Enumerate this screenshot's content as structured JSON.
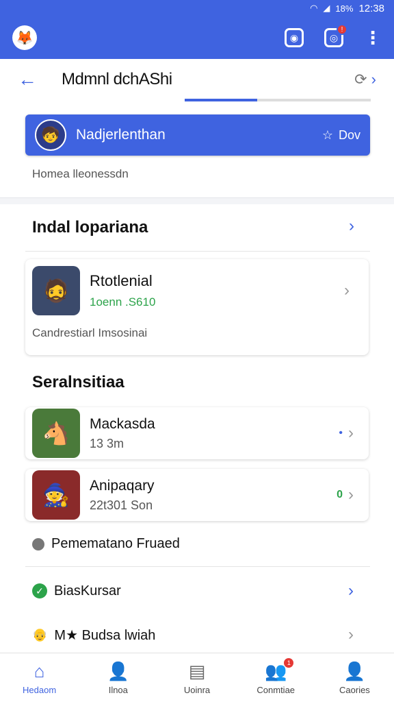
{
  "status": {
    "time": "12:38",
    "battery": "18%"
  },
  "header": {
    "badge": "!"
  },
  "titlebar": {
    "title": "Mdmnl dchAShi"
  },
  "account": {
    "name": "Nadjerlenthan",
    "action": "Dov"
  },
  "subcaption": "Homea lleonessdn",
  "section1": {
    "title": "Indal lopariana",
    "card": {
      "name": "Rtotlenial",
      "price": "1oenn .S610",
      "caption": "Candrestiarl Imsosinai"
    }
  },
  "section2": {
    "title": "Seralnsitiaa",
    "rows": [
      {
        "name": "Mackasda",
        "sub": "13 3m",
        "indicator": "•"
      },
      {
        "name": "Anipaqary",
        "sub": "22t301 Son",
        "indicator": "0"
      }
    ]
  },
  "plain_items": [
    {
      "label": "Pemematano Fruaed"
    },
    {
      "label": "BiasKursar"
    },
    {
      "label": "M★ Budsa lwiah"
    }
  ],
  "tabs": [
    {
      "label": "Hedaom",
      "icon": "home-icon"
    },
    {
      "label": "Ilnoa",
      "icon": "person-icon"
    },
    {
      "label": "Uoinra",
      "icon": "news-icon"
    },
    {
      "label": "Conmtiae",
      "icon": "people-icon",
      "badge": "1"
    },
    {
      "label": "Caories",
      "icon": "profile-icon"
    }
  ],
  "colors": {
    "accent": "#3f63e0",
    "success": "#2ca34a"
  }
}
